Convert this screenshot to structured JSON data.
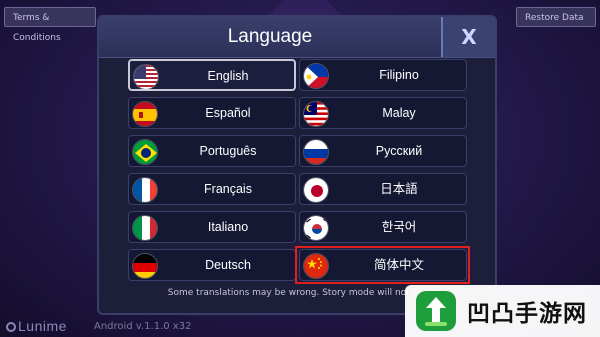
{
  "topbar": {
    "terms_label": "Terms & Conditions",
    "restore_label": "Restore Data"
  },
  "dialog": {
    "title": "Language",
    "close_label": "X",
    "footer_note": "Some translations may be wrong. Story mode will not be t",
    "languages": [
      {
        "label": "English",
        "flag": "us-flag-icon",
        "selected": true
      },
      {
        "label": "Filipino",
        "flag": "philippines-flag-icon"
      },
      {
        "label": "Español",
        "flag": "spain-flag-icon"
      },
      {
        "label": "Malay",
        "flag": "malaysia-flag-icon"
      },
      {
        "label": "Português",
        "flag": "brazil-flag-icon"
      },
      {
        "label": "Русский",
        "flag": "russia-flag-icon"
      },
      {
        "label": "Français",
        "flag": "france-flag-icon"
      },
      {
        "label": "日本語",
        "flag": "japan-flag-icon"
      },
      {
        "label": "Italiano",
        "flag": "italy-flag-icon"
      },
      {
        "label": "한국어",
        "flag": "korea-flag-icon"
      },
      {
        "label": "Deutsch",
        "flag": "germany-flag-icon"
      },
      {
        "label": "简体中文",
        "flag": "china-flag-icon",
        "highlighted": true
      }
    ]
  },
  "brand": {
    "name": "Lunime",
    "version": "Android v.1.1.0 x32"
  },
  "watermark": {
    "text": "凹凸手游网"
  },
  "colors": {
    "highlight": "#e02020",
    "dialog_bg": "#1c1e3a",
    "close_bg": "#3a4272"
  }
}
